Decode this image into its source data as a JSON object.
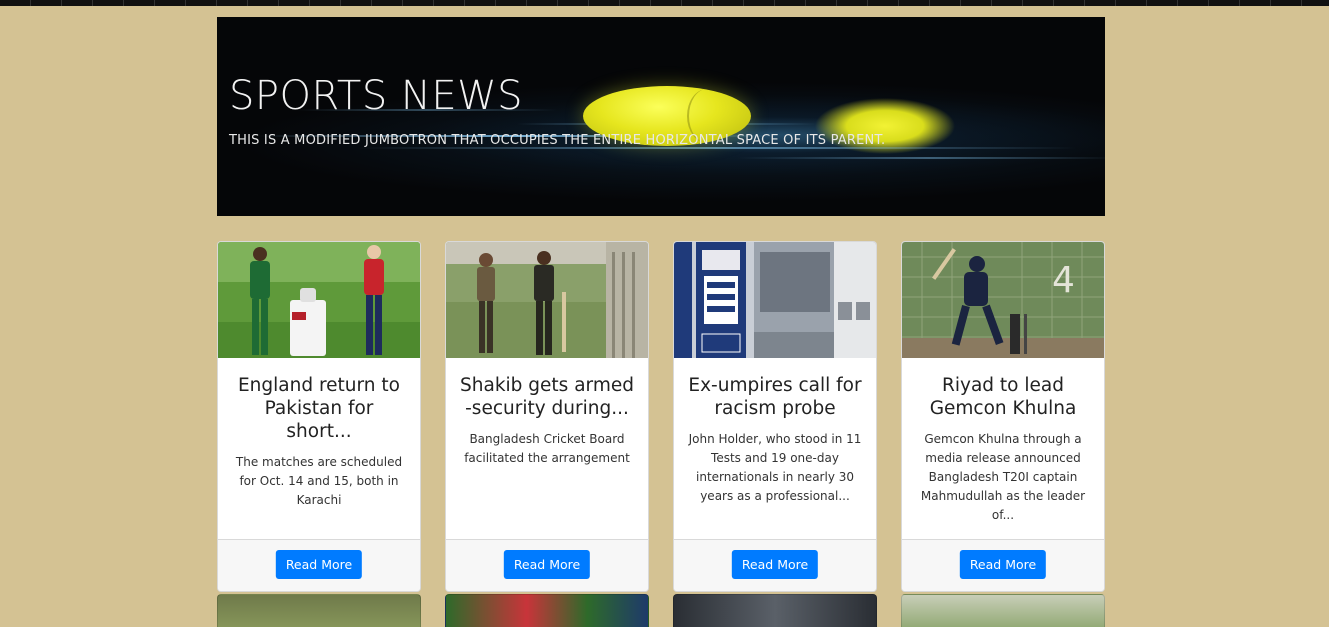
{
  "jumbotron": {
    "title": "SPORTS NEWS",
    "subtitle": "THIS IS A MODIFIED JUMBOTRON THAT OCCUPIES THE ENTIRE HORIZONTAL SPACE OF ITS PARENT."
  },
  "cards": [
    {
      "title": "England return to Pakistan for short...",
      "text": "The matches are scheduled for Oct. 14 and 15, both in Karachi",
      "button": "Read More",
      "image": "cricket-captains-trophy-image"
    },
    {
      "title": "Shakib gets armed -security during...",
      "text": "Bangladesh Cricket Board facilitated the arrangement",
      "button": "Read More",
      "image": "cricketers-walking-image"
    },
    {
      "title": "Ex-umpires call for racism probe",
      "text": "John Holder, who stood in 11 Tests and 19 one-day internationals in nearly 30 years as a professional...",
      "button": "Read More",
      "image": "ecb-logo-image"
    },
    {
      "title": "Riyad to lead Gemcon Khulna",
      "text": "Gemcon Khulna through a media release announced Bangladesh T20I captain Mahmudullah as the leader of...",
      "button": "Read More",
      "image": "batsman-nets-image"
    }
  ],
  "colors": {
    "page_background": "#d4c293",
    "button": "#007bff",
    "card_footer": "#f7f7f7"
  }
}
